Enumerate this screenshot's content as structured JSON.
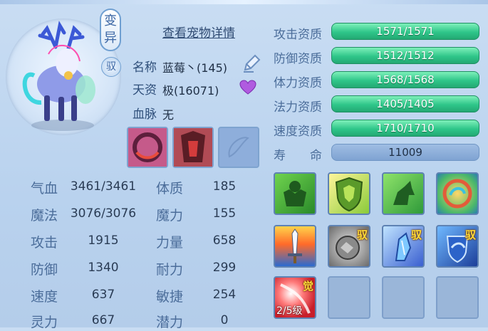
{
  "pet": {
    "badge_variant": "变异",
    "badge_tamed": "驭",
    "view_details": "查看宠物详情",
    "name_label": "名称",
    "name_value": "蓝莓丶(145)",
    "aptitude_label": "天资",
    "aptitude_value": "极(16071)",
    "bloodline_label": "血脉",
    "bloodline_value": "无"
  },
  "stats": [
    {
      "label": "气血",
      "value": "3461/3461",
      "label2": "体质",
      "value2": "185"
    },
    {
      "label": "魔法",
      "value": "3076/3076",
      "label2": "魔力",
      "value2": "155"
    },
    {
      "label": "攻击",
      "value": "1915",
      "label2": "力量",
      "value2": "658"
    },
    {
      "label": "防御",
      "value": "1340",
      "label2": "耐力",
      "value2": "299"
    },
    {
      "label": "速度",
      "value": "637",
      "label2": "敏捷",
      "value2": "254"
    },
    {
      "label": "灵力",
      "value": "667",
      "label2": "潜力",
      "value2": "0"
    }
  ],
  "aptitudes": [
    {
      "label": "攻击资质",
      "value": "1571/1571"
    },
    {
      "label": "防御资质",
      "value": "1512/1512"
    },
    {
      "label": "体力资质",
      "value": "1568/1568"
    },
    {
      "label": "法力资质",
      "value": "1405/1405"
    },
    {
      "label": "速度资质",
      "value": "1710/1710"
    }
  ],
  "lifespan": {
    "label": "寿　　命",
    "value": "11009"
  },
  "skills": {
    "tag_tamed": "驭",
    "tag_awaken": "觉",
    "awaken_level": "2/5级"
  },
  "colors": {
    "aptitude_bar": "#2fc68a",
    "background": "#c9ddf3",
    "label_blue": "#4b6d9a"
  }
}
